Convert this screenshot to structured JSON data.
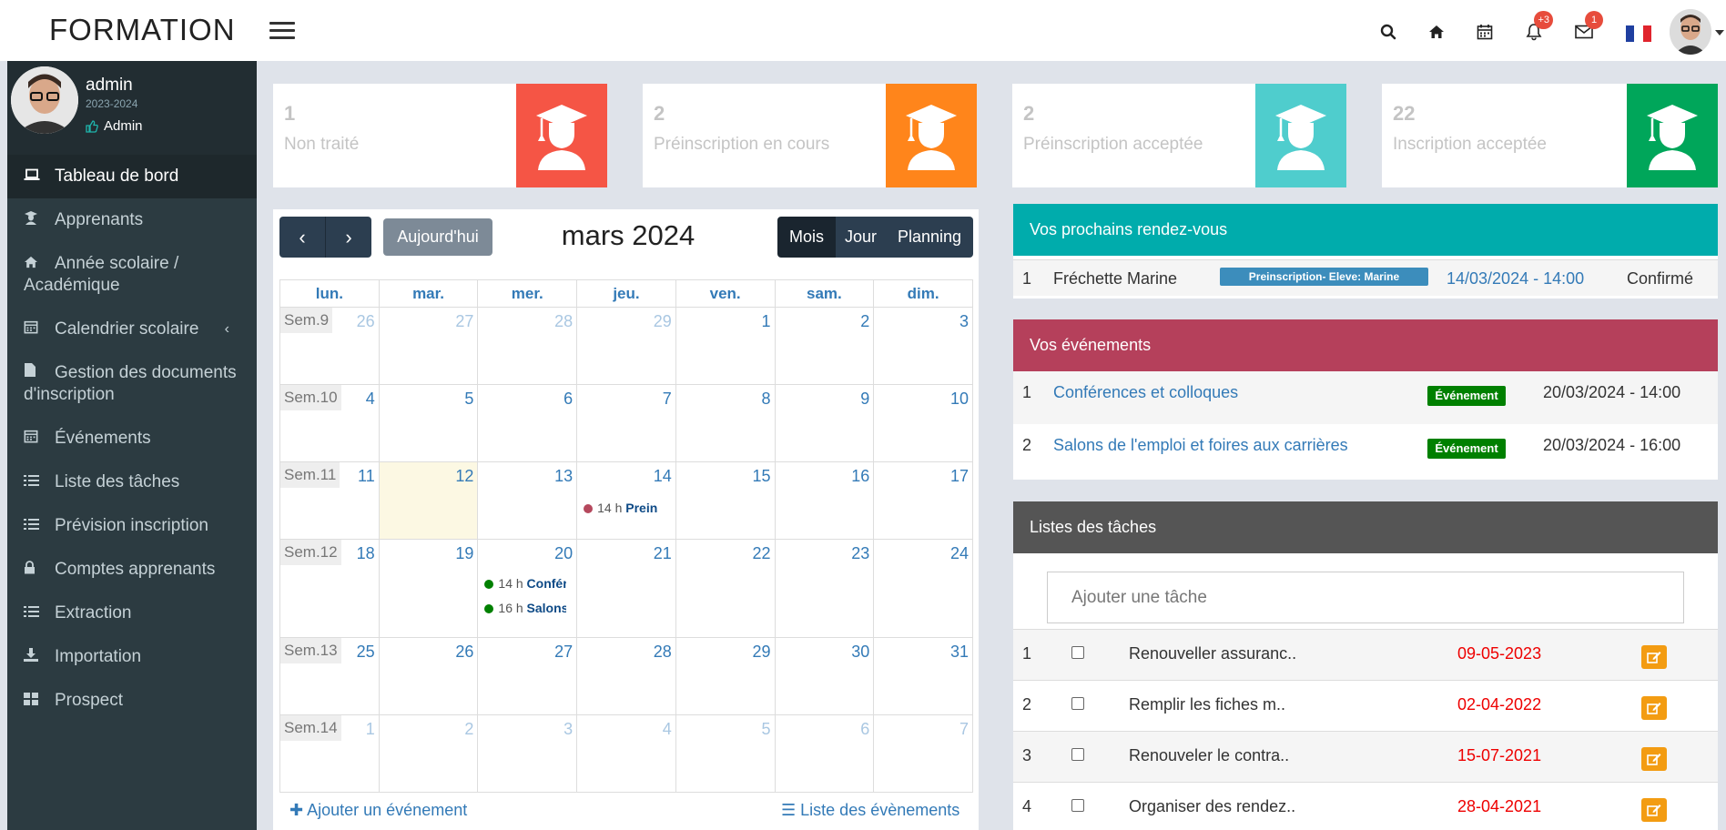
{
  "app": {
    "brand": "FORMATION"
  },
  "topbar": {
    "notifications_badge": "+3",
    "messages_badge": "1",
    "icons": [
      "search-icon",
      "home-icon",
      "calendar-icon",
      "bell-icon",
      "envelope-icon"
    ]
  },
  "user": {
    "name": "admin",
    "year": "2023-2024",
    "role": "Admin"
  },
  "sidebar": {
    "items": [
      {
        "label": "Tableau de bord",
        "icon": "laptop-icon"
      },
      {
        "label": "Apprenants",
        "icon": "graduate-icon"
      },
      {
        "label": "Année scolaire / Académique",
        "icon": "home-icon"
      },
      {
        "label": "Calendrier scolaire",
        "icon": "calendar-icon"
      },
      {
        "label": "Gestion des documents d'inscription",
        "icon": "file-icon"
      },
      {
        "label": "Événements",
        "icon": "calendar-icon"
      },
      {
        "label": "Liste des tâches",
        "icon": "list-icon"
      },
      {
        "label": "Prévision inscription",
        "icon": "list-icon"
      },
      {
        "label": "Comptes apprenants",
        "icon": "lock-icon"
      },
      {
        "label": "Extraction",
        "icon": "list-icon"
      },
      {
        "label": "Importation",
        "icon": "download-icon"
      },
      {
        "label": "Prospect",
        "icon": "grid-icon"
      }
    ]
  },
  "stats": [
    {
      "value": "1",
      "label": "Non traité",
      "color": "#f55545"
    },
    {
      "value": "2",
      "label": "Préinscription en cours",
      "color": "#ff851b"
    },
    {
      "value": "2",
      "label": "Préinscription acceptée",
      "color": "#4fcdcd"
    },
    {
      "value": "22",
      "label": "Inscription acceptée",
      "color": "#00a65a"
    }
  ],
  "calendar": {
    "today_label": "Aujourd'hui",
    "title": "mars 2024",
    "views": [
      "Mois",
      "Jour",
      "Planning"
    ],
    "day_headers": [
      "lun.",
      "mar.",
      "mer.",
      "jeu.",
      "ven.",
      "sam.",
      "dim."
    ],
    "weeks": [
      {
        "label": "Sem.9",
        "days": [
          "26",
          "27",
          "28",
          "29",
          "1",
          "2",
          "3"
        ]
      },
      {
        "label": "Sem.10",
        "days": [
          "4",
          "5",
          "6",
          "7",
          "8",
          "9",
          "10"
        ]
      },
      {
        "label": "Sem.11",
        "days": [
          "11",
          "12",
          "13",
          "14",
          "15",
          "16",
          "17"
        ]
      },
      {
        "label": "Sem.12",
        "days": [
          "18",
          "19",
          "20",
          "21",
          "22",
          "23",
          "24"
        ]
      },
      {
        "label": "Sem.13",
        "days": [
          "25",
          "26",
          "27",
          "28",
          "29",
          "30",
          "31"
        ]
      },
      {
        "label": "Sem.14",
        "days": [
          "1",
          "2",
          "3",
          "4",
          "5",
          "6",
          "7"
        ]
      }
    ],
    "events": [
      {
        "time": "14 h",
        "title": "Preinscription",
        "color": "#b5485d"
      },
      {
        "time": "14 h",
        "title": "Conférences",
        "color": "#008000"
      },
      {
        "time": "16 h",
        "title": "Salons",
        "color": "#008000"
      }
    ],
    "add_event": "Ajouter un événement",
    "list_events": "Liste des évènements"
  },
  "rdv": {
    "title": "Vos prochains rendez-vous",
    "header_color": "#00acac",
    "rows": [
      {
        "n": "1",
        "name": "Fréchette Marine",
        "tag": "Preinscription- Eleve: Marine",
        "date": "14/03/2024 - 14:00",
        "status": "Confirmé"
      }
    ]
  },
  "events_panel": {
    "title": "Vos événements",
    "header_color": "#b5405b",
    "rows": [
      {
        "n": "1",
        "name": "Conférences et colloques",
        "tag": "Événement",
        "date": "20/03/2024 - 14:00"
      },
      {
        "n": "2",
        "name": "Salons de l'emploi et foires aux carrières",
        "tag": "Événement",
        "date": "20/03/2024 - 16:00"
      }
    ]
  },
  "tasks": {
    "title": "Listes des tâches",
    "header_color": "#555555",
    "placeholder": "Ajouter une tâche",
    "rows": [
      {
        "n": "1",
        "text": "Renouveller assuranc..",
        "date": "09-05-2023"
      },
      {
        "n": "2",
        "text": "Remplir les fiches m..",
        "date": "02-04-2022"
      },
      {
        "n": "3",
        "text": "Renouveler le contra..",
        "date": "15-07-2021"
      },
      {
        "n": "4",
        "text": "Organiser des rendez..",
        "date": "28-04-2021"
      }
    ]
  }
}
